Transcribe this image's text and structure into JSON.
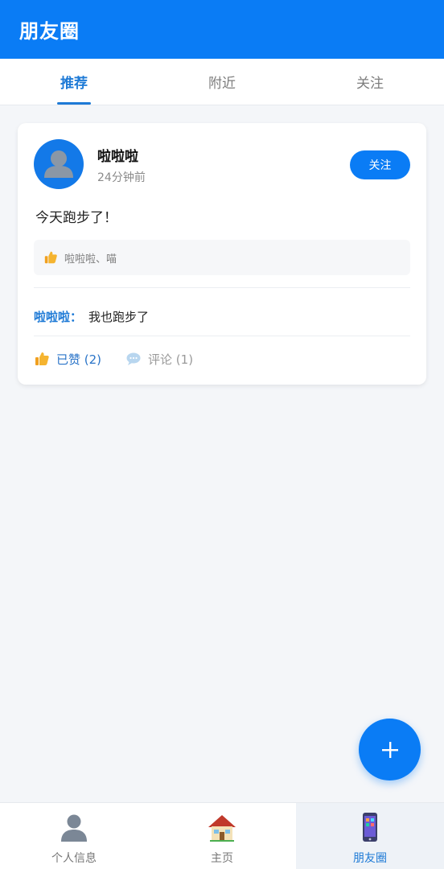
{
  "app_bar": {
    "title": "朋友圈"
  },
  "tabs": [
    {
      "label": "推荐",
      "active": true
    },
    {
      "label": "附近",
      "active": false
    },
    {
      "label": "关注",
      "active": false
    }
  ],
  "post": {
    "user_name": "啦啦啦",
    "time": "24分钟前",
    "follow_label": "关注",
    "content": "今天跑步了！",
    "likers": "啦啦啦、喵",
    "comment": {
      "author": "啦啦啦：",
      "text": "我也跑步了"
    },
    "like_label": "已赞 (2)",
    "comment_label": "评论 (1)"
  },
  "fab": {
    "icon": "plus-icon"
  },
  "bottom_nav": [
    {
      "label": "个人信息",
      "icon": "person-icon",
      "active": false
    },
    {
      "label": "主页",
      "icon": "house-icon",
      "active": false
    },
    {
      "label": "朋友圈",
      "icon": "phone-icon",
      "active": true
    }
  ],
  "colors": {
    "primary": "#0a7cf5",
    "accent_text": "#1e7ad6",
    "background": "#f4f6f9"
  }
}
